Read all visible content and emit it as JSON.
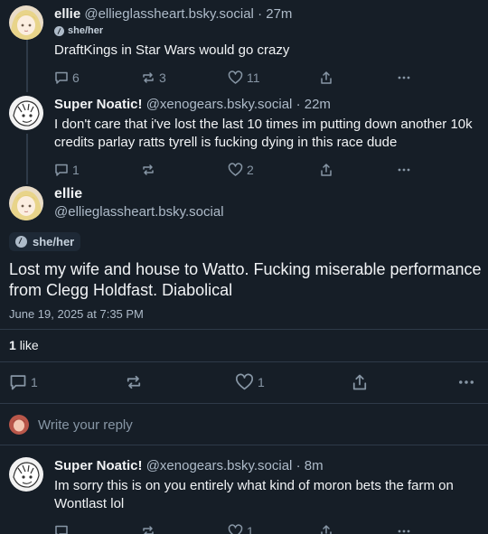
{
  "posts": [
    {
      "name": "ellie",
      "handle": "@ellieglassheart.bsky.social",
      "separator": "·",
      "time": "27m",
      "pronouns": "she/her",
      "text": "DraftKings in Star Wars would go crazy",
      "replies": "6",
      "reposts": "3",
      "likes": "11"
    },
    {
      "name": "Super Noatic!",
      "handle": "@xenogears.bsky.social",
      "separator": "·",
      "time": "22m",
      "text": "I don't care that i've lost the last 10 times im putting down another 10k credits parlay ratts tyrell is fucking dying in this race dude",
      "replies": "1",
      "reposts": "",
      "likes": "2"
    }
  ],
  "focused": {
    "name": "ellie",
    "handle": "@ellieglassheart.bsky.social",
    "pronouns": "she/her",
    "text": "Lost my wife and house to Watto. Fucking miserable performance from Clegg Holdfast. Diabolical",
    "date": "June 19, 2025 at 7:35 PM",
    "like_count": "1",
    "like_word": "like",
    "replies": "1",
    "likes": "1"
  },
  "reply_box": {
    "placeholder": "Write your reply"
  },
  "reply": {
    "name": "Super Noatic!",
    "handle": "@xenogears.bsky.social",
    "separator": "·",
    "time": "8m",
    "text": "Im sorry this is on you entirely what kind of moron bets the farm on Wontlast lol",
    "replies": "",
    "reposts": "",
    "likes": "1"
  },
  "icons": {
    "reply": "speech-bubble-icon",
    "repost": "repost-arrows-icon",
    "like": "heart-icon",
    "share": "share-upload-icon",
    "more": "more-dots-icon"
  },
  "colors": {
    "background": "#161e27",
    "muted": "#8796a5",
    "divider": "#2e3a48"
  }
}
